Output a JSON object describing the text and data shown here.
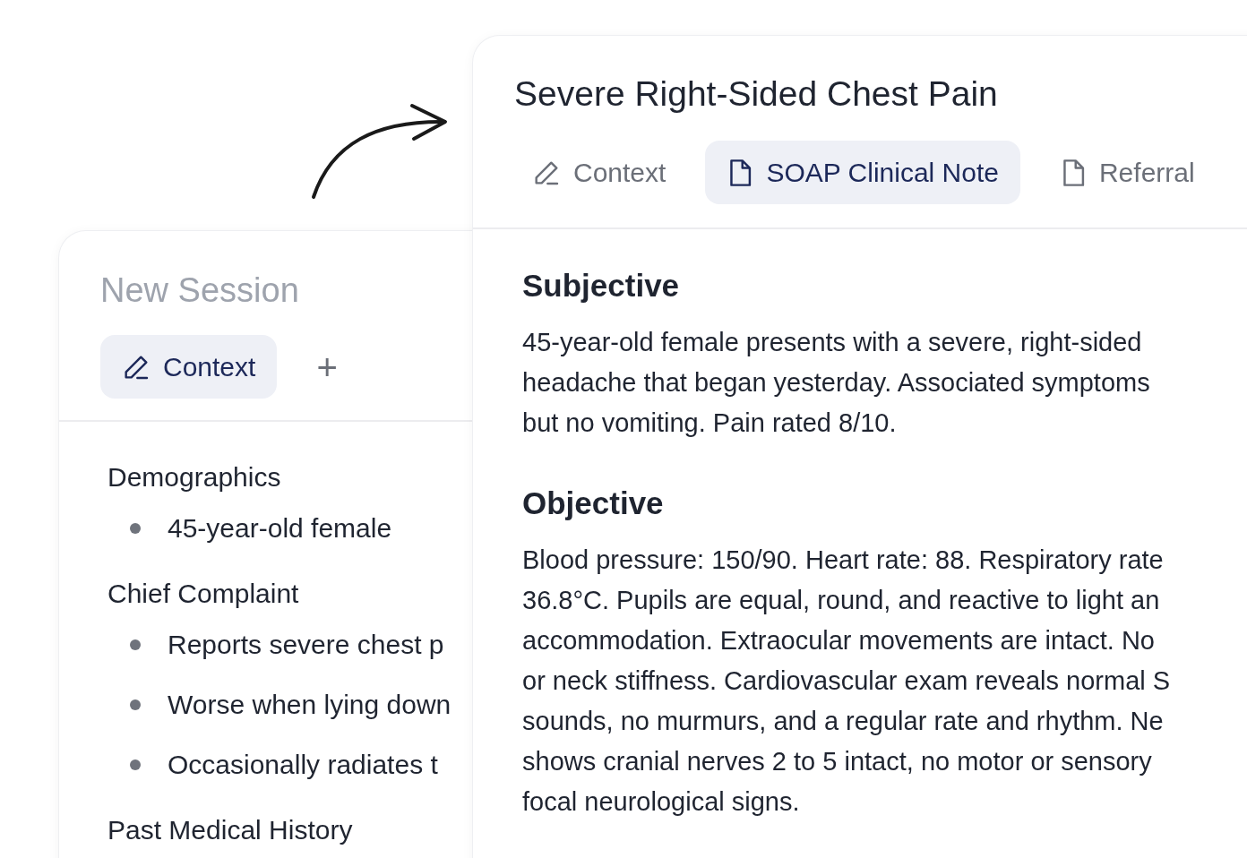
{
  "back_card": {
    "title": "New Session",
    "tabs": [
      {
        "label": "Context",
        "selected": true
      }
    ],
    "add_button": "+",
    "sections": [
      {
        "heading": "Demographics",
        "items": [
          "45-year-old female"
        ]
      },
      {
        "heading": "Chief Complaint",
        "items": [
          "Reports severe chest p",
          "Worse when lying down",
          "Occasionally radiates t"
        ]
      },
      {
        "heading": "Past Medical History"
      }
    ]
  },
  "front_card": {
    "title": "Severe Right-Sided Chest Pain",
    "tabs": [
      {
        "label": "Context",
        "selected": false
      },
      {
        "label": "SOAP Clinical Note",
        "selected": true
      },
      {
        "label": "Referral",
        "selected": false
      }
    ],
    "sections": [
      {
        "heading": "Subjective",
        "lines": [
          "45-year-old female presents with a severe, right-sided",
          "headache that began yesterday. Associated symptoms",
          "but no vomiting. Pain rated 8/10."
        ]
      },
      {
        "heading": "Objective",
        "lines": [
          "Blood pressure: 150/90. Heart rate: 88. Respiratory rate",
          "36.8°C. Pupils are equal, round, and reactive to light an",
          "accommodation. Extraocular movements are intact. No",
          "or neck stiffness. Cardiovascular exam reveals normal S",
          "sounds, no murmurs, and a regular rate and rhythm. Ne",
          "shows cranial nerves 2 to 5 intact, no motor or sensory",
          "focal neurological signs."
        ]
      }
    ]
  }
}
